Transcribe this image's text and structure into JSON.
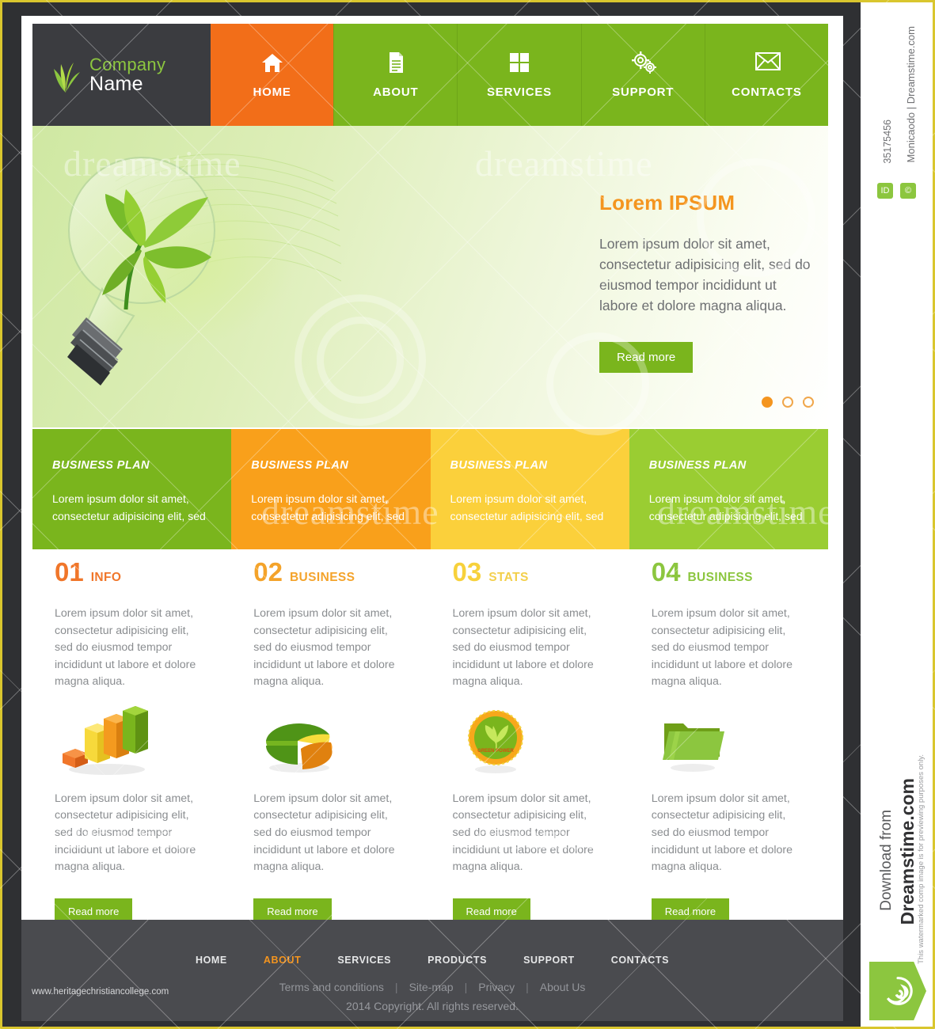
{
  "brand": {
    "line1": "Company",
    "line2": "Name",
    "logo_icon": "leaf-logo-icon"
  },
  "nav": {
    "items": [
      {
        "label": "HOME",
        "icon": "home-icon",
        "active": true
      },
      {
        "label": "ABOUT",
        "icon": "document-icon",
        "active": false
      },
      {
        "label": "SERVICES",
        "icon": "grid-squares-icon",
        "active": false
      },
      {
        "label": "SUPPORT",
        "icon": "gears-icon",
        "active": false
      },
      {
        "label": "CONTACTS",
        "icon": "envelope-icon",
        "active": false
      }
    ]
  },
  "hero": {
    "title": "Lorem IPSUM",
    "text": "Lorem ipsum dolor sit amet, consectetur adipisicing elit, sed do eiusmod tempor incididunt ut labore et dolore magna aliqua.",
    "button": "Read more",
    "image_icon": "green-lightbulb-leaf-icon",
    "slides": 3,
    "active_slide": 1
  },
  "plans": [
    {
      "title": "BUSINESS PLAN",
      "text": "Lorem ipsum dolor sit amet, consectetur adipisicing elit, sed",
      "color": "#7ab51d"
    },
    {
      "title": "BUSINESS PLAN",
      "text": "Lorem ipsum dolor sit amet, consectetur adipisicing elit, sed",
      "color": "#f9a01b"
    },
    {
      "title": "BUSINESS PLAN",
      "text": "Lorem ipsum dolor sit amet, consectetur adipisicing elit, sed",
      "color": "#fbd03b"
    },
    {
      "title": "BUSINESS PLAN",
      "text": "Lorem ipsum dolor sit amet, consectetur adipisicing elit, sed",
      "color": "#9acd32"
    }
  ],
  "columns": [
    {
      "num": "01",
      "name": "INFO",
      "num_color": "#f0762a",
      "name_color": "#f0762a",
      "text_top": "Lorem ipsum dolor sit amet, consectetur adipisicing elit, sed do eiusmod tempor incididunt ut labore et dolore magna aliqua.",
      "icon": "bar-chart-3d-icon",
      "text_bottom": "Lorem ipsum dolor sit amet, consectetur adipisicing elit, sed do eiusmod tempor incididunt ut labore et dolore magna aliqua.",
      "button": "Read more"
    },
    {
      "num": "02",
      "name": "BUSINESS",
      "num_color": "#f4a32a",
      "name_color": "#f4a32a",
      "text_top": "Lorem ipsum dolor sit amet, consectetur adipisicing elit, sed do eiusmod tempor incididunt ut labore et dolore magna aliqua.",
      "icon": "pie-chart-3d-icon",
      "text_bottom": "Lorem ipsum dolor sit amet, consectetur adipisicing elit, sed do eiusmod tempor incididunt ut labore et dolore magna aliqua.",
      "button": "Read more"
    },
    {
      "num": "03",
      "name": "STATS",
      "num_color": "#f7d13b",
      "name_color": "#f3cf4a",
      "text_top": "Lorem ipsum dolor sit amet, consectetur adipisicing elit, sed do eiusmod tempor incididunt ut labore et dolore magna aliqua.",
      "icon": "green-power-badge-icon",
      "text_bottom": "Lorem ipsum dolor sit amet, consectetur adipisicing elit, sed do eiusmod tempor incididunt ut labore et dolore magna aliqua.",
      "button": "Read more"
    },
    {
      "num": "04",
      "name": "BUSINESS",
      "num_color": "#8cc63f",
      "name_color": "#8cc63f",
      "text_top": "Lorem ipsum dolor sit amet, consectetur adipisicing elit, sed do eiusmod tempor incididunt ut labore et dolore magna aliqua.",
      "icon": "folder-icon",
      "text_bottom": "Lorem ipsum dolor sit amet, consectetur adipisicing elit, sed do eiusmod tempor incididunt ut labore et dolore magna aliqua.",
      "button": "Read more"
    }
  ],
  "footer": {
    "nav": [
      {
        "label": "HOME",
        "active": false
      },
      {
        "label": "ABOUT",
        "active": true
      },
      {
        "label": "SERVICES",
        "active": false
      },
      {
        "label": "PRODUCTS",
        "active": false
      },
      {
        "label": "SUPPORT",
        "active": false
      },
      {
        "label": "CONTACTS",
        "active": false
      }
    ],
    "links": [
      "Terms and conditions",
      "Site-map",
      "Privacy",
      "About Us"
    ],
    "separator": "|",
    "copyright": "2014 Copyright. All rights reserved.",
    "site_url": "www.heritagechristiancollege.com"
  },
  "watermark": {
    "credit": "Monicaodo | Dreamstime.com",
    "image_id": "35175456",
    "id_badge": "ID",
    "credit_badge": "©",
    "download_from": "Download from",
    "brand": "Dreamstime.com",
    "note": "This watermarked comp image is for previewing purposes only.",
    "word": "dreamstime",
    "swirl_icon": "dreamstime-swirl-icon",
    "scissors_icon": "scissors-icon"
  },
  "colors": {
    "nav_green": "#7ab51d",
    "nav_orange": "#f26e19",
    "brand_dark": "#3b3c40",
    "footer_dark": "#4a4b4f",
    "accent_orange": "#f4951f",
    "frame_yellow": "#d9c62e"
  }
}
